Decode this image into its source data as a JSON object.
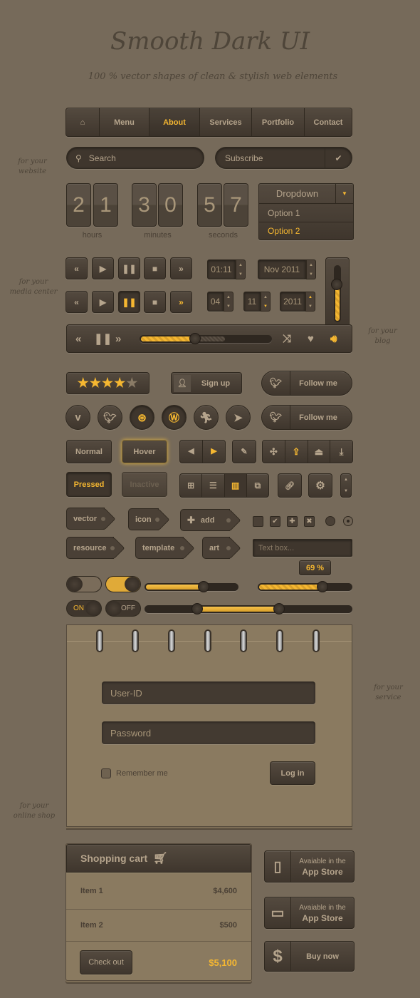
{
  "header": {
    "title": "Smooth Dark UI",
    "subtitle": "100 % vector shapes of clean & stylish web elements"
  },
  "notes": {
    "website": "for your website",
    "media": "for your media center",
    "blog": "for your blog",
    "service": "for your service",
    "shop": "for your online shop"
  },
  "nav": {
    "home_icon": "home-icon",
    "items": [
      "Menu",
      "About",
      "Services",
      "Portfolio",
      "Contact"
    ],
    "active": "About"
  },
  "search": {
    "placeholder": "Search",
    "icon": "search-icon"
  },
  "subscribe": {
    "placeholder": "Subscribe",
    "icon": "check-icon"
  },
  "countdown": {
    "hours": [
      "2",
      "1"
    ],
    "minutes": [
      "3",
      "0"
    ],
    "seconds": [
      "5",
      "7"
    ],
    "labels": {
      "hours": "hours",
      "minutes": "minutes",
      "seconds": "seconds"
    }
  },
  "dropdown": {
    "label": "Dropdown",
    "options": [
      "Option 1",
      "Option 2"
    ],
    "selected": "Option 2"
  },
  "spinners": {
    "time": "01:11",
    "month_year": "Nov 2011",
    "day": "04",
    "month": "11",
    "year": "2011"
  },
  "player": {
    "progress_percent": 42,
    "buffer_percent": 65,
    "volume_percent": 70
  },
  "rating": {
    "value": 4,
    "max": 5
  },
  "signup": {
    "label": "Sign up"
  },
  "follow": {
    "label": "Follow me"
  },
  "social_icons": [
    "vimeo-icon",
    "twitter-icon",
    "dribbble-icon",
    "wordpress-icon",
    "runner-icon",
    "paper-plane-icon"
  ],
  "buttons": {
    "normal": "Normal",
    "hover": "Hover",
    "pressed": "Pressed",
    "inactive": "Inactive"
  },
  "tags": [
    "vector",
    "icon",
    "add",
    "resource",
    "template",
    "art"
  ],
  "textbox": {
    "placeholder": "Text box..."
  },
  "sliders": {
    "slider1_percent": 63,
    "slider2_percent": 69,
    "slider2_label": "69 %",
    "range": [
      25,
      65
    ]
  },
  "toggles": {
    "on": "ON",
    "off": "OFF"
  },
  "login": {
    "user_placeholder": "User-ID",
    "password_placeholder": "Password",
    "remember": "Remember me",
    "submit": "Log in"
  },
  "cart": {
    "title": "Shopping cart",
    "items": [
      {
        "name": "Item 1",
        "price": "$4,600"
      },
      {
        "name": "Item 2",
        "price": "$500"
      }
    ],
    "checkout": "Check out",
    "total": "$5,100"
  },
  "store": {
    "line1": "Avaiable in the",
    "line2": "App Store",
    "buy": "Buy now"
  },
  "colors": {
    "accent": "#f5b731",
    "background": "#766a5a",
    "control": "#4a4036",
    "paper": "#8a7a60"
  }
}
